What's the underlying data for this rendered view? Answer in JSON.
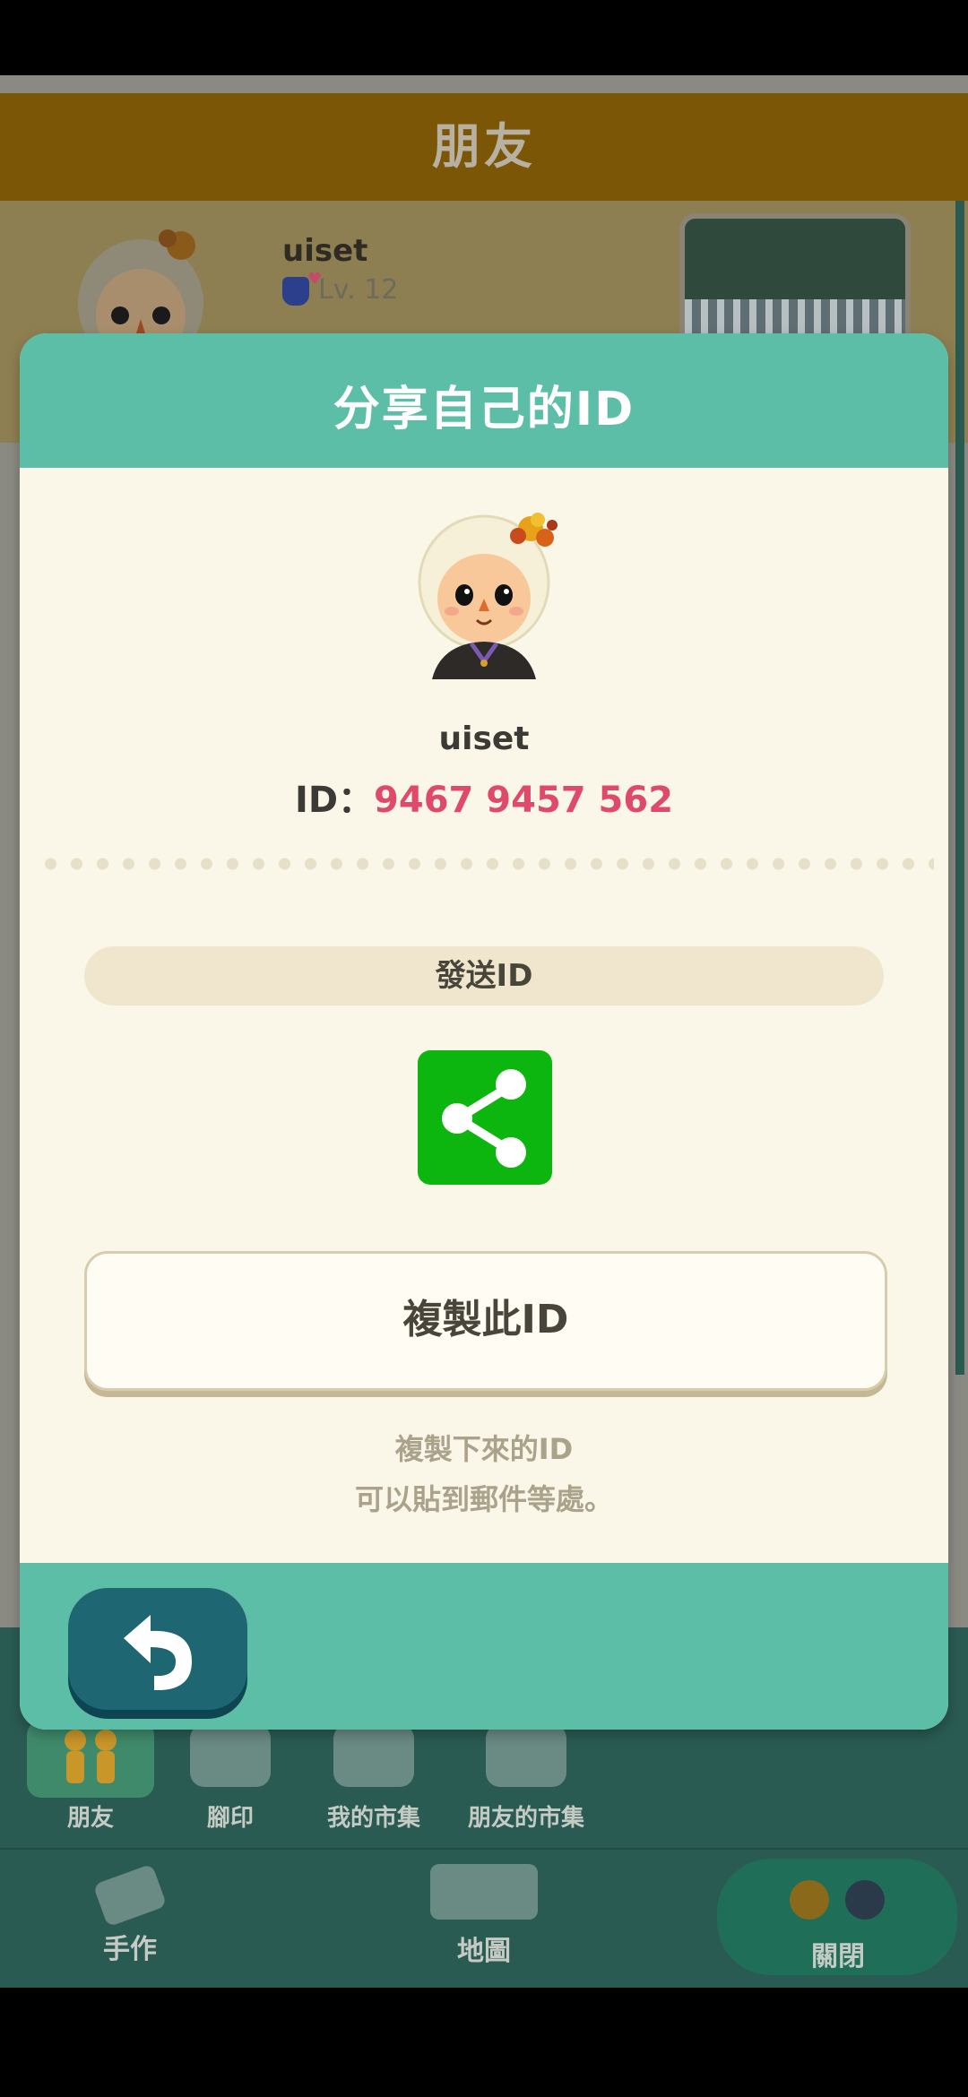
{
  "background": {
    "title": "朋友",
    "friend": {
      "name": "uiset",
      "level": "Lv. 12"
    },
    "tabs": [
      "朋友",
      "腳印",
      "我的市集",
      "朋友的市集"
    ],
    "nav": [
      "手作",
      "地圖",
      "關閉"
    ]
  },
  "modal": {
    "title": "分享自己的ID",
    "user_name": "uiset",
    "id_label": "ID：",
    "id_value": "9467 9457 562",
    "send_label": "發送ID",
    "copy_button": "複製此ID",
    "hint_line1": "複製下來的ID",
    "hint_line2": "可以貼到郵件等處。"
  },
  "icons": {
    "share": "share-icon",
    "back": "undo-arrow-icon"
  },
  "colors": {
    "teal": "#5dbea8",
    "id_pink": "#e04a6a",
    "share_green": "#0db60e",
    "back_navy": "#1f6673"
  }
}
